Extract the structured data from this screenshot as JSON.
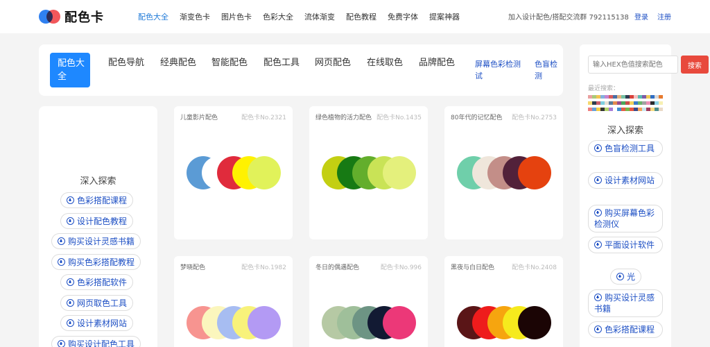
{
  "header": {
    "logo_text": "配色卡",
    "nav": [
      "配色大全",
      "渐变色卡",
      "图片色卡",
      "色彩大全",
      "流体渐变",
      "配色教程",
      "免费字体",
      "提案神器"
    ],
    "active_nav": "配色大全",
    "join_info": "加入设计配色/搭配交流群 792115138",
    "login": "登录",
    "register": "注册"
  },
  "categories": {
    "items": [
      "配色大全",
      "配色导航",
      "经典配色",
      "智能配色",
      "配色工具",
      "网页配色",
      "在线取色",
      "品牌配色"
    ],
    "links": [
      "屏幕色彩检测试",
      "色盲检测"
    ]
  },
  "left_explore": {
    "title": "深入探索",
    "tags": [
      "色彩搭配课程",
      "设计配色教程",
      "购买设计灵感书籍",
      "购买色彩搭配教程",
      "色彩搭配软件",
      "网页取色工具",
      "设计素材网站",
      "购买设计配色工具"
    ]
  },
  "cards": [
    {
      "title": "儿童影片配色",
      "no": "配色卡No.2321",
      "colors": [
        "#5b9bd5",
        "#ffffff",
        "#e02b3c",
        "#fff200",
        "#e1f25a"
      ]
    },
    {
      "title": "绿色植物的活力配色",
      "no": "配色卡No.1435",
      "colors": [
        "#c3cf12",
        "#177a14",
        "#63ae2c",
        "#c9e356",
        "#e4f07c"
      ]
    },
    {
      "title": "80年代的记忆配色",
      "no": "配色卡No.2753",
      "colors": [
        "#6fcfaa",
        "#efe6db",
        "#c38e88",
        "#52213a",
        "#e5420f"
      ]
    },
    {
      "title": "梦晓配色",
      "no": "配色卡No.1982",
      "colors": [
        "#f79490",
        "#fbf6bd",
        "#a7bdf2",
        "#f8f27a",
        "#b39af4"
      ]
    },
    {
      "title": "冬日的偶遇配色",
      "no": "配色卡No.996",
      "colors": [
        "#b6c9a4",
        "#9fbf9a",
        "#6d9484",
        "#121a33",
        "#ec3878"
      ]
    },
    {
      "title": "黑夜与白日配色",
      "no": "配色卡No.2408",
      "colors": [
        "#5a1517",
        "#ee1c1c",
        "#f6a50f",
        "#f6ea1d",
        "#1b0505"
      ]
    }
  ],
  "right_sidebar": {
    "search_placeholder": "输入HEX色值搜索配色",
    "search_button": "搜索",
    "recent_label": "最近搜索：",
    "recent_palettes": [
      [
        "#e9a0a0",
        "#a9c97a",
        "#f1c453",
        "#82b1dd",
        "#c584d1",
        "#d85c5c",
        "#4a6fa5",
        "#e2b17d",
        "#73c0a4"
      ],
      [
        "#f5d86f",
        "#2d3e50",
        "#c95e6b",
        "#7fcfe0",
        "#e7e0d6",
        "#5a7d9a",
        "#e48b4e",
        "#9a4a8b",
        "#4aa85a"
      ],
      [
        "#ef7e7e",
        "#67a0d8",
        "#f6ce46",
        "#343434",
        "#b4d46a",
        "#a77cd9",
        "#ffffff",
        "#3f8fd2",
        "#e55c46"
      ],
      [
        "#2f3a52",
        "#d7413b",
        "#f3c0c0",
        "#5ab9b2",
        "#7c5ca8",
        "#eecb5a",
        "#2f6ec4",
        "#d8d8d8",
        "#e77a2e"
      ],
      [
        "#c94c4c",
        "#f2d05c",
        "#3a7bc8",
        "#68b36b",
        "#a1a1a1",
        "#ec8fb5",
        "#2b2b2b",
        "#8dd3e6",
        "#f7f0b3"
      ],
      [
        "#7ab648",
        "#e8563f",
        "#3b4b8a",
        "#f4a259",
        "#c7e6f0",
        "#a33b5c",
        "#f6dc82",
        "#4d8f8c",
        "#ead9c6"
      ]
    ],
    "explore_title": "深入探索",
    "tags": [
      "色盲检测工具",
      "设计素材网站",
      "购买屏幕色彩检测仪",
      "平面设计软件",
      "光",
      "购买设计灵感书籍",
      "色彩搭配课程"
    ]
  }
}
